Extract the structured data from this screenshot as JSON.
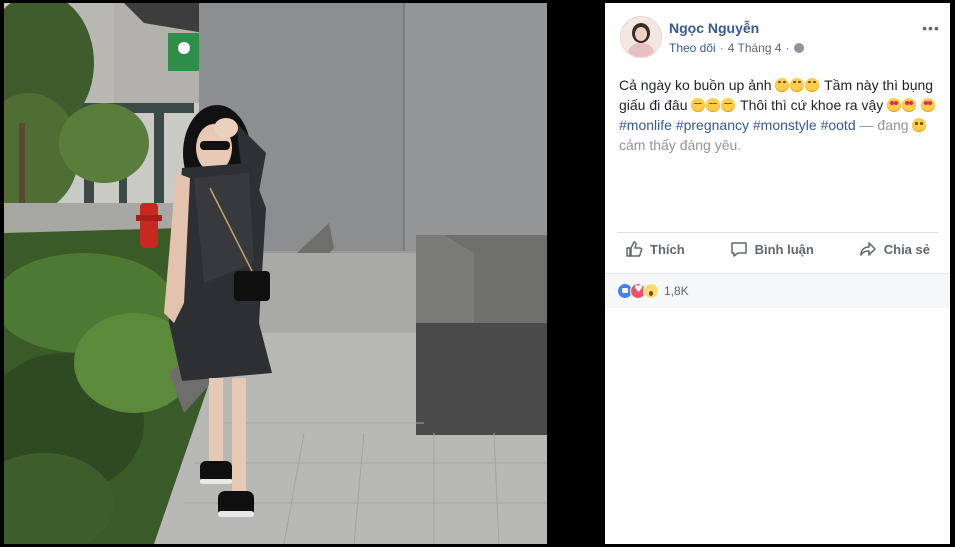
{
  "post": {
    "author": "Ngọc Nguyễn",
    "follow_label": "Theo dõi",
    "separator": "·",
    "date": "4 Tháng 4",
    "text_part1": "Cả ngày ko buồn up ảnh",
    "text_part2": "Tầm này thì bụng giấu đi đâu",
    "text_part3": "Thôi thì cứ khoe ra vậy",
    "hashtags": [
      "#monlife",
      "#pregnancy",
      "#monstyle",
      "#ootd"
    ],
    "feeling_prefix": "— đang",
    "feeling": "cảm thấy đáng yêu.",
    "privacy_icon": "globe-icon",
    "more_icon": "ellipsis-icon"
  },
  "actions": {
    "like": "Thích",
    "comment": "Bình luận",
    "share": "Chia sẻ"
  },
  "reactions": {
    "types": [
      "like",
      "love",
      "wow"
    ],
    "count": "1,8K"
  },
  "colors": {
    "link": "#365899",
    "text": "#1d2129",
    "muted": "#616770",
    "background": "#000000",
    "panel": "#ffffff"
  }
}
